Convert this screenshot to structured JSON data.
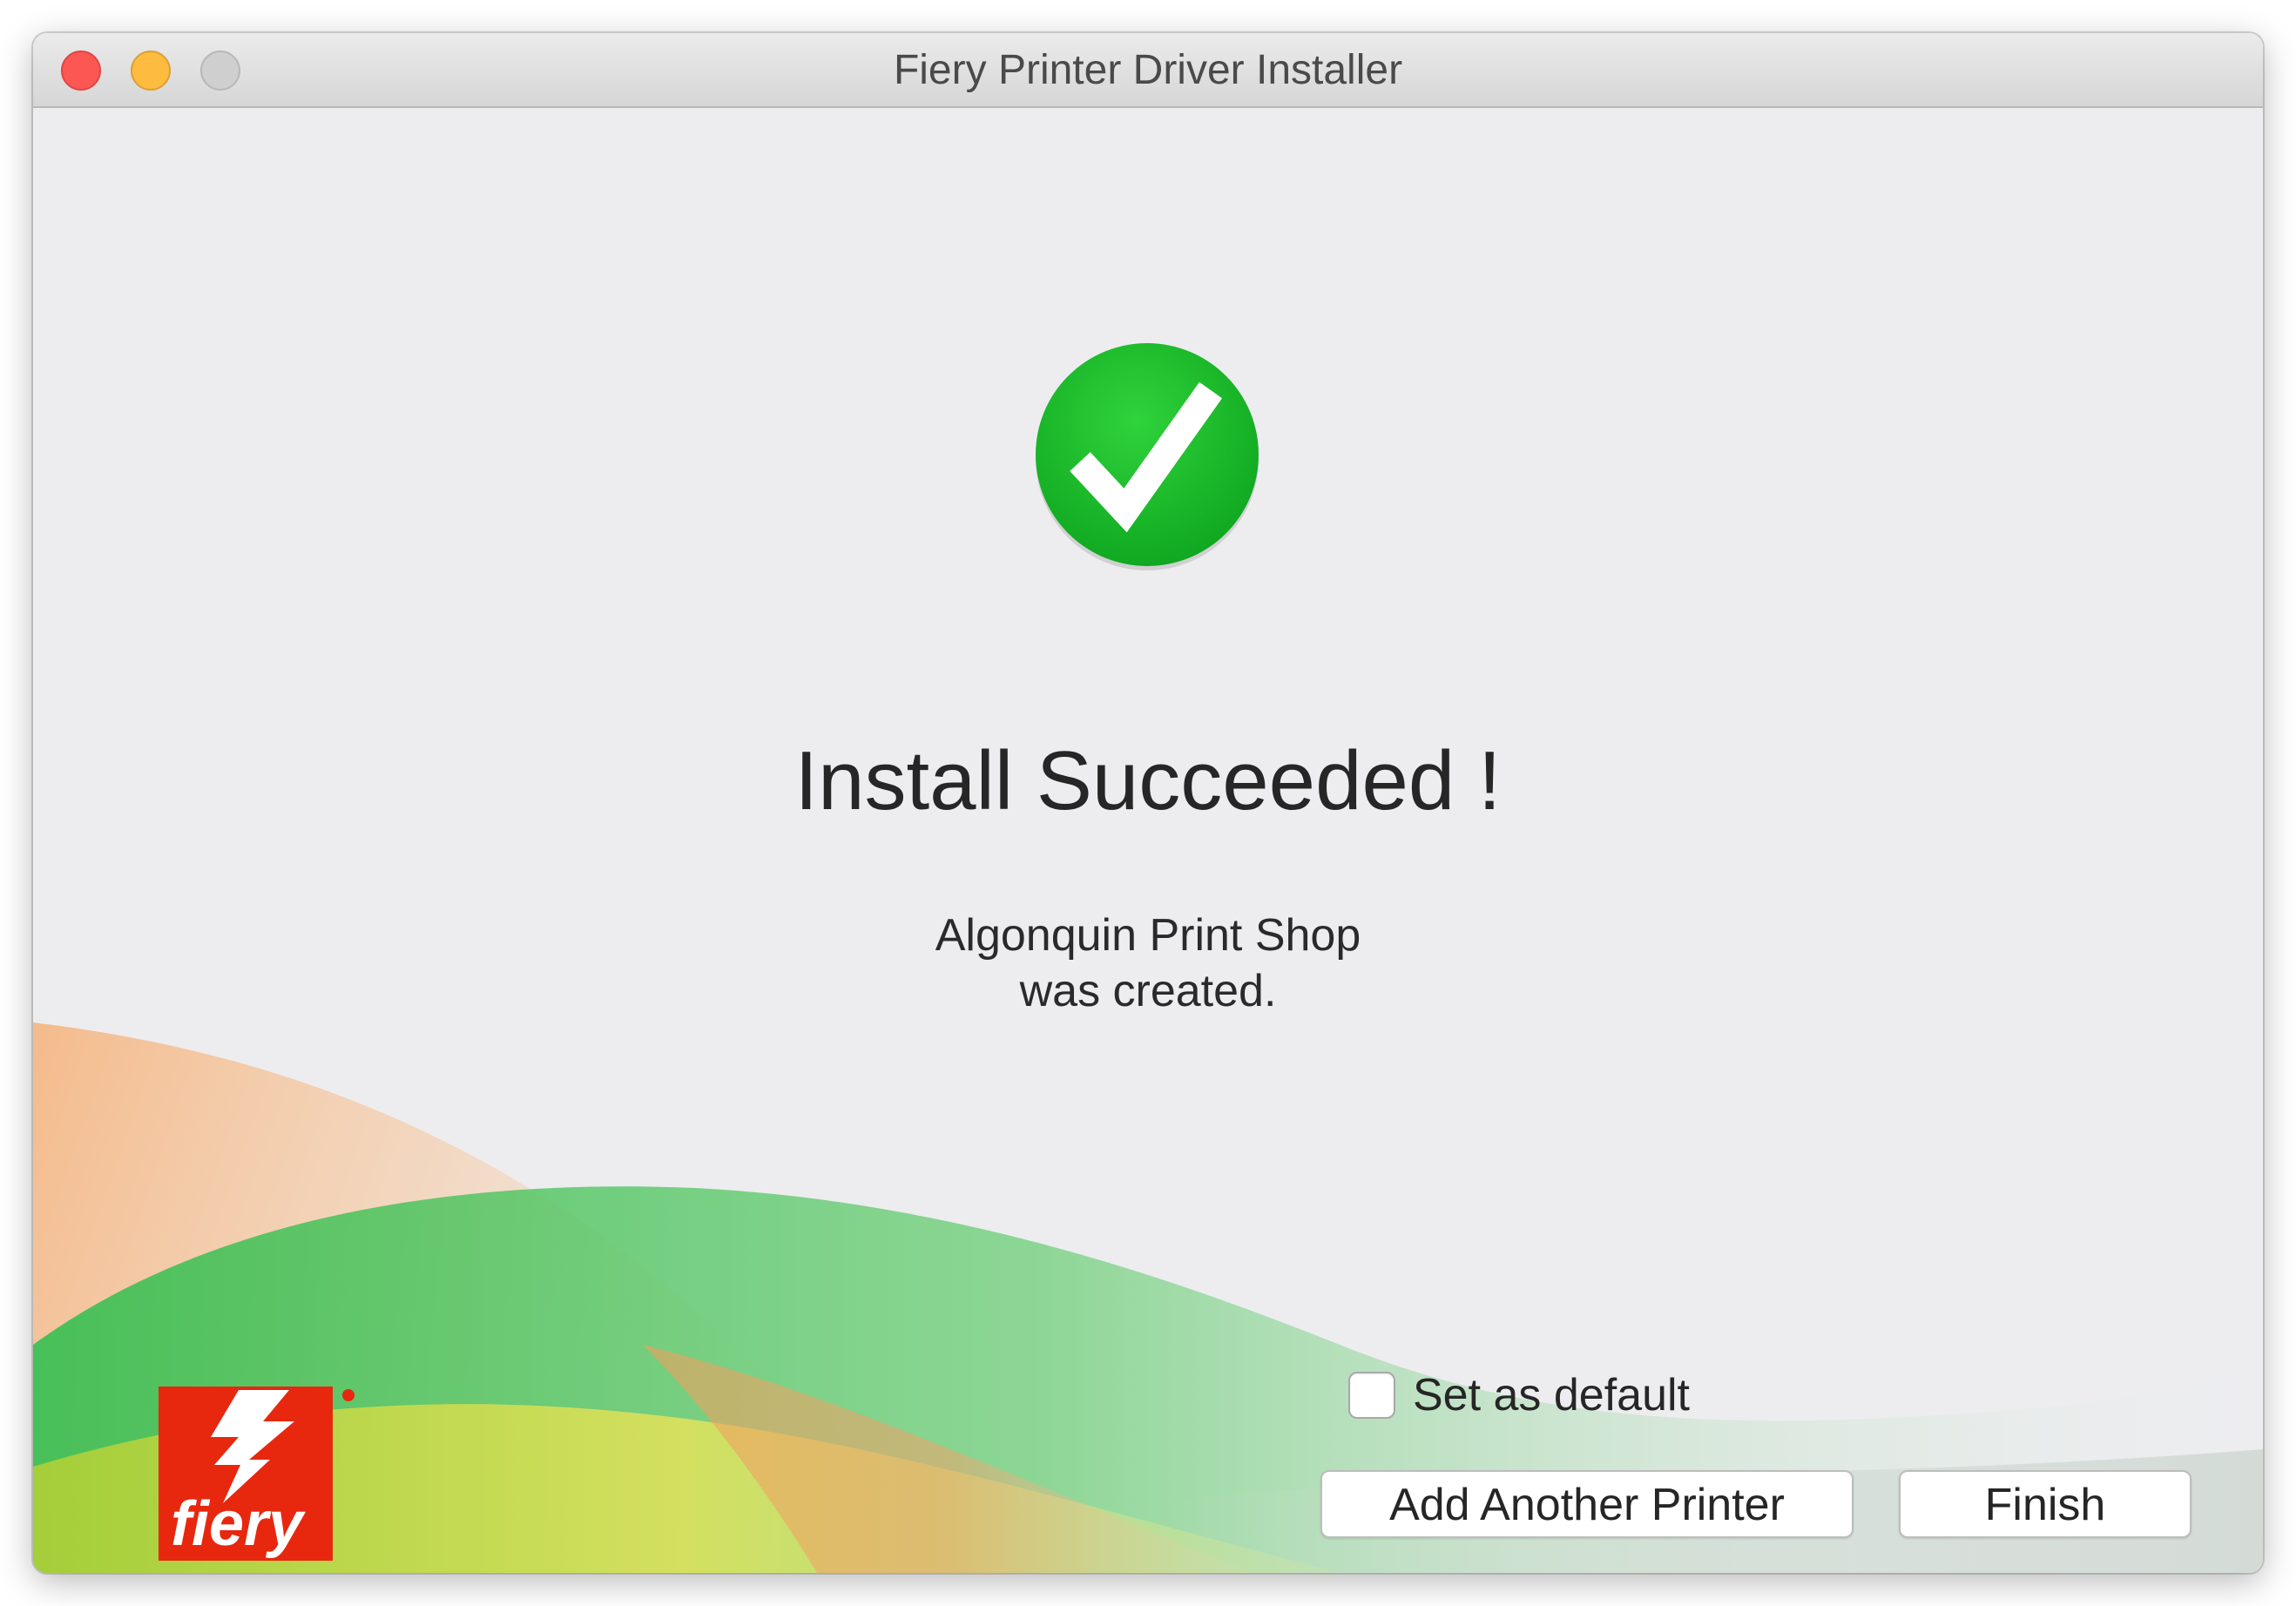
{
  "window": {
    "title": "Fiery Printer Driver Installer"
  },
  "result": {
    "headline": "Install Succeeded !",
    "printer_name": "Algonquin Print Shop",
    "created_text": "was created."
  },
  "options": {
    "set_default_label": "Set as default",
    "set_default_checked": false
  },
  "buttons": {
    "add_another": "Add Another Printer",
    "finish": "Finish"
  },
  "branding": {
    "logo_text": "fiery",
    "logo_color": "#e8270f"
  },
  "colors": {
    "success_green": "#18b82a",
    "close": "#fc5753",
    "minimize": "#fdbc40",
    "maximize": "#cfcfcf"
  },
  "icons": {
    "status": "checkmark-circle-icon",
    "logo": "fiery-logo-icon"
  }
}
